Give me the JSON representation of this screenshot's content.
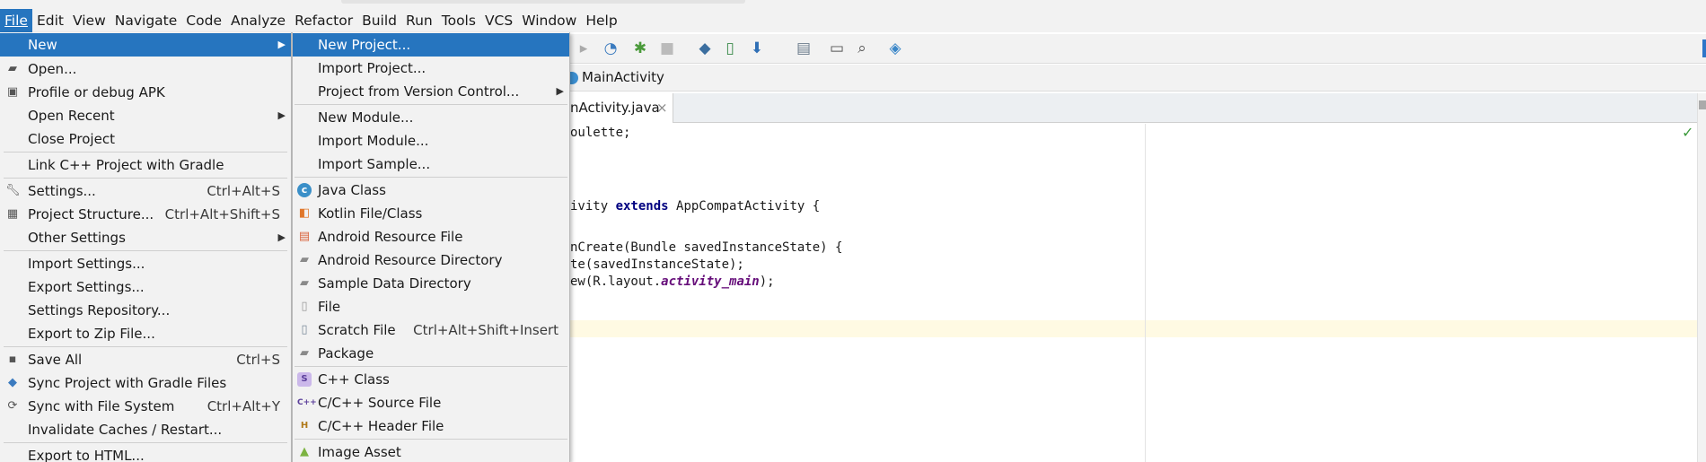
{
  "menubar": {
    "items": [
      "File",
      "Edit",
      "View",
      "Navigate",
      "Code",
      "Analyze",
      "Refactor",
      "Build",
      "Run",
      "Tools",
      "VCS",
      "Window",
      "Help"
    ]
  },
  "file_menu": {
    "items": [
      {
        "label": "New",
        "icon": "",
        "shortcut": "",
        "submenu": true
      },
      {
        "label": "Open...",
        "icon": "folder-icon",
        "shortcut": ""
      },
      {
        "label": "Profile or debug APK",
        "icon": "apk-icon",
        "shortcut": ""
      },
      {
        "label": "Open Recent",
        "icon": "",
        "shortcut": "",
        "submenu": true
      },
      {
        "label": "Close Project",
        "icon": "",
        "shortcut": ""
      },
      {
        "label": "Link C++ Project with Gradle",
        "icon": "",
        "shortcut": ""
      },
      {
        "label": "Settings...",
        "icon": "wrench-icon",
        "shortcut": "Ctrl+Alt+S"
      },
      {
        "label": "Project Structure...",
        "icon": "project-structure-icon",
        "shortcut": "Ctrl+Alt+Shift+S"
      },
      {
        "label": "Other Settings",
        "icon": "",
        "shortcut": "",
        "submenu": true
      },
      {
        "label": "Import Settings...",
        "icon": "",
        "shortcut": ""
      },
      {
        "label": "Export Settings...",
        "icon": "",
        "shortcut": ""
      },
      {
        "label": "Settings Repository...",
        "icon": "",
        "shortcut": ""
      },
      {
        "label": "Export to Zip File...",
        "icon": "",
        "shortcut": ""
      },
      {
        "label": "Save All",
        "icon": "save-icon",
        "shortcut": "Ctrl+S"
      },
      {
        "label": "Sync Project with Gradle Files",
        "icon": "gradle-sync-icon",
        "shortcut": ""
      },
      {
        "label": "Sync with File System",
        "icon": "sync-icon",
        "shortcut": "Ctrl+Alt+Y"
      },
      {
        "label": "Invalidate Caches / Restart...",
        "icon": "",
        "shortcut": ""
      },
      {
        "label": "Export to HTML...",
        "icon": "",
        "shortcut": ""
      }
    ]
  },
  "new_menu": {
    "items": [
      {
        "label": "New Project...",
        "icon": "",
        "shortcut": ""
      },
      {
        "label": "Import Project...",
        "icon": "",
        "shortcut": ""
      },
      {
        "label": "Project from Version Control...",
        "icon": "",
        "shortcut": "",
        "submenu": true
      },
      {
        "label": "New Module...",
        "icon": "",
        "shortcut": ""
      },
      {
        "label": "Import Module...",
        "icon": "",
        "shortcut": ""
      },
      {
        "label": "Import Sample...",
        "icon": "",
        "shortcut": ""
      },
      {
        "label": "Java Class",
        "icon": "java-class-icon",
        "shortcut": ""
      },
      {
        "label": "Kotlin File/Class",
        "icon": "kotlin-file-icon",
        "shortcut": ""
      },
      {
        "label": "Android Resource File",
        "icon": "android-resource-file-icon",
        "shortcut": ""
      },
      {
        "label": "Android Resource Directory",
        "icon": "android-resource-directory-icon",
        "shortcut": ""
      },
      {
        "label": "Sample Data Directory",
        "icon": "folder-icon",
        "shortcut": ""
      },
      {
        "label": "File",
        "icon": "file-icon",
        "shortcut": ""
      },
      {
        "label": "Scratch File",
        "icon": "scratch-file-icon",
        "shortcut": "Ctrl+Alt+Shift+Insert"
      },
      {
        "label": "Package",
        "icon": "package-icon",
        "shortcut": ""
      },
      {
        "label": "C++ Class",
        "icon": "cpp-class-icon",
        "shortcut": ""
      },
      {
        "label": "C/C++ Source File",
        "icon": "cpp-source-file-icon",
        "shortcut": ""
      },
      {
        "label": "C/C++ Header File",
        "icon": "cpp-header-file-icon",
        "shortcut": ""
      },
      {
        "label": "Image Asset",
        "icon": "image-asset-icon",
        "shortcut": ""
      }
    ]
  },
  "navbar": {
    "crumb": "MainActivity"
  },
  "editor_tab": {
    "label": "nActivity.java",
    "close": "×"
  },
  "code_lines": [
    "oulette;",
    "ivity extends AppCompatActivity {",
    "nCreate(Bundle savedInstanceState) {",
    "te(savedInstanceState);",
    "ew(R.layout.activity_main);"
  ],
  "colors": {
    "selection": "#2675bf",
    "menu_bg": "#f2f2f2",
    "keyword": "#000080",
    "field": "#660e7a"
  }
}
